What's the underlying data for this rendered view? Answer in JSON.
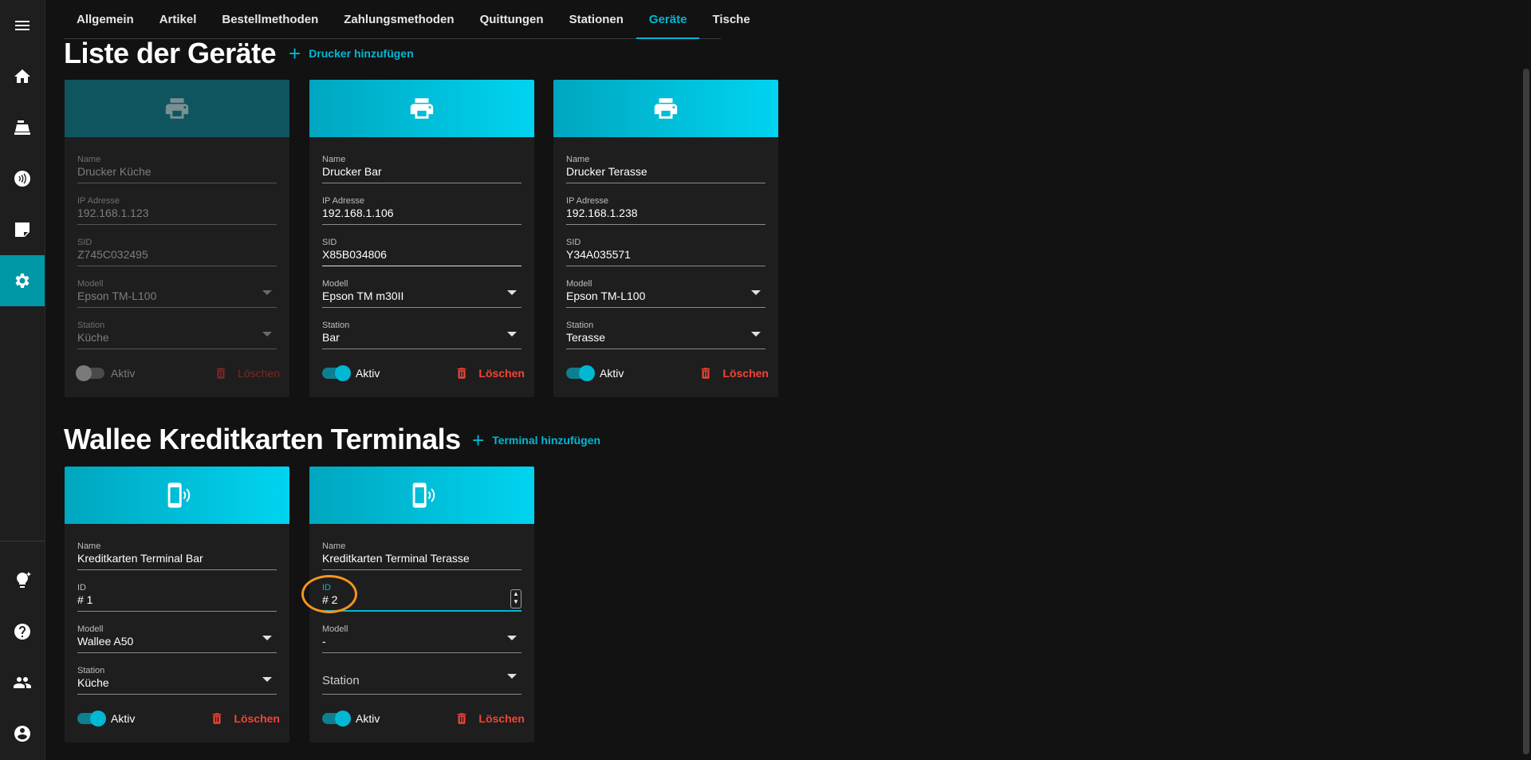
{
  "colors": {
    "accent": "#00b8d4",
    "danger": "#f44336",
    "highlight": "#f7941d",
    "sidebar_active": "#0097a7"
  },
  "sidebar": {
    "items": [
      {
        "icon": "menu-icon"
      },
      {
        "icon": "home-icon"
      },
      {
        "icon": "cash-register-icon"
      },
      {
        "icon": "contactless-icon"
      },
      {
        "icon": "notes-icon"
      },
      {
        "icon": "settings-icon",
        "active": true
      },
      {
        "icon": "lightbulb-icon"
      },
      {
        "icon": "help-icon"
      },
      {
        "icon": "people-icon"
      },
      {
        "icon": "account-icon"
      }
    ]
  },
  "tabs": [
    {
      "label": "Allgemein"
    },
    {
      "label": "Artikel"
    },
    {
      "label": "Bestellmethoden"
    },
    {
      "label": "Zahlungsmethoden"
    },
    {
      "label": "Quittungen"
    },
    {
      "label": "Stationen"
    },
    {
      "label": "Geräte",
      "active": true
    },
    {
      "label": "Tische"
    }
  ],
  "printers_section": {
    "title": "Liste der Geräte",
    "add_label": "Drucker hinzufügen",
    "cards": [
      {
        "enabled": false,
        "name_label": "Name",
        "name": "Drucker Küche",
        "ip_label": "IP Adresse",
        "ip": "192.168.1.123",
        "sid_label": "SID",
        "sid": "Z745C032495",
        "model_label": "Modell",
        "model": "Epson TM-L100",
        "station_label": "Station",
        "station": "Küche",
        "active_label": "Aktiv",
        "delete_label": "Löschen"
      },
      {
        "enabled": true,
        "name_label": "Name",
        "name": "Drucker Bar",
        "ip_label": "IP Adresse",
        "ip": "192.168.1.106",
        "sid_label": "SID",
        "sid": "X85B034806",
        "model_label": "Modell",
        "model": "Epson TM m30II",
        "station_label": "Station",
        "station": "Bar",
        "active_label": "Aktiv",
        "delete_label": "Löschen"
      },
      {
        "enabled": true,
        "name_label": "Name",
        "name": "Drucker Terasse",
        "ip_label": "IP Adresse",
        "ip": "192.168.1.238",
        "sid_label": "SID",
        "sid": "Y34A035571",
        "model_label": "Modell",
        "model": "Epson TM-L100",
        "station_label": "Station",
        "station": "Terasse",
        "active_label": "Aktiv",
        "delete_label": "Löschen"
      }
    ]
  },
  "terminals_section": {
    "title": "Wallee Kreditkarten Terminals",
    "add_label": "Terminal hinzufügen",
    "cards": [
      {
        "name_label": "Name",
        "name": "Kreditkarten Terminal Bar",
        "id_label": "ID",
        "id": "# 1",
        "model_label": "Modell",
        "model": "Wallee A50",
        "station_label": "Station",
        "station": "Küche",
        "active_label": "Aktiv",
        "delete_label": "Löschen"
      },
      {
        "name_label": "Name",
        "name": "Kreditkarten Terminal Terasse",
        "id_label": "ID",
        "id": "# 2",
        "model_label": "Modell",
        "model": "-",
        "station_placeholder": "Station",
        "active_label": "Aktiv",
        "delete_label": "Löschen"
      }
    ]
  }
}
